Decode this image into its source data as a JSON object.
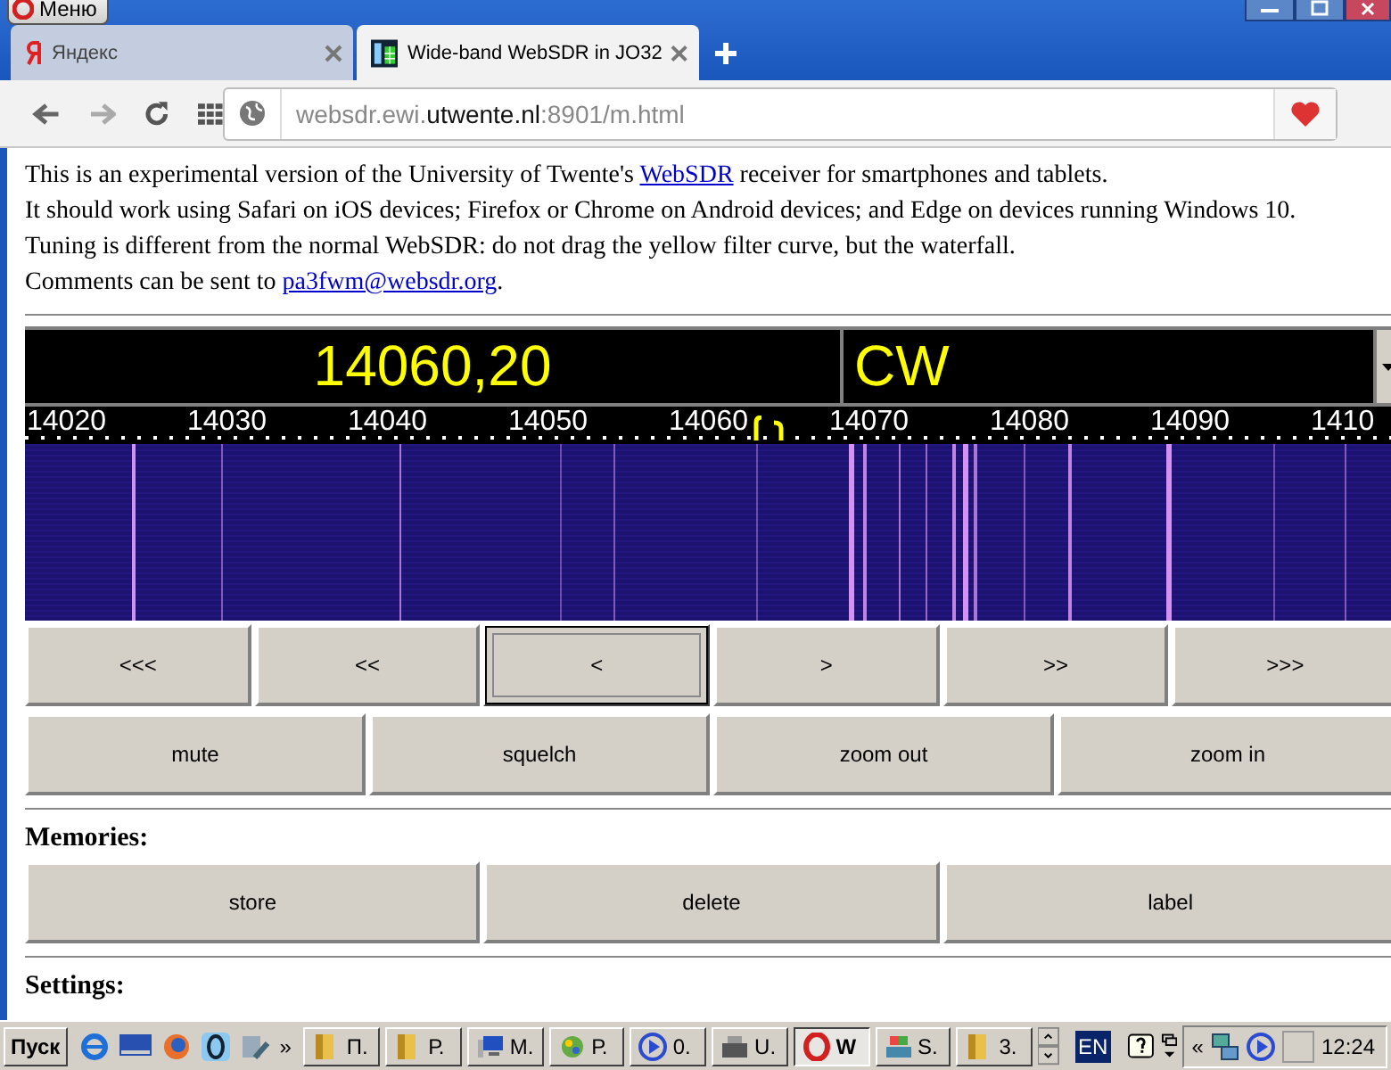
{
  "browser": {
    "menu_label": "Меню",
    "tabs": [
      {
        "title": "Яндекс",
        "selected": false
      },
      {
        "title": "Wide-band WebSDR in JO32",
        "selected": true
      }
    ],
    "url": {
      "host_prefix": "websdr.ewi.",
      "host_domain": "utwente.nl",
      "path": ":8901/m.html"
    }
  },
  "intro": [
    {
      "parts": [
        {
          "kind": "text",
          "text": "This is an experimental version of the University of Twente's "
        },
        {
          "kind": "link",
          "text": "WebSDR"
        },
        {
          "kind": "text",
          "text": " receiver for smartphones and tablets."
        }
      ]
    },
    {
      "parts": [
        {
          "kind": "text",
          "text": "It should work using Safari on iOS devices; Firefox or Chrome on Android devices; and Edge on devices running Windows 10."
        }
      ]
    },
    {
      "parts": [
        {
          "kind": "text",
          "text": "Tuning is different from the normal WebSDR: do not drag the yellow filter curve, but the waterfall."
        }
      ]
    },
    {
      "parts": [
        {
          "kind": "text",
          "text": "Comments can be sent to "
        },
        {
          "kind": "link",
          "text": "pa3fwm@websdr.org"
        },
        {
          "kind": "text",
          "text": "."
        }
      ]
    }
  ],
  "tuner": {
    "frequency": "14060,20",
    "mode": "CW",
    "scale": [
      "14020",
      "14030",
      "14040",
      "14050",
      "14060",
      "14070",
      "14080",
      "14090",
      "1410"
    ]
  },
  "controls": [
    [
      {
        "label": "<<<",
        "selected": false
      },
      {
        "label": "<<",
        "selected": false
      },
      {
        "label": "<",
        "selected": true
      },
      {
        "label": ">",
        "selected": false
      },
      {
        "label": ">>",
        "selected": false
      },
      {
        "label": ">>>",
        "selected": false
      }
    ],
    [
      {
        "label": "mute",
        "selected": false
      },
      {
        "label": "squelch",
        "selected": false
      },
      {
        "label": "zoom out",
        "selected": false
      },
      {
        "label": "zoom in",
        "selected": false
      }
    ]
  ],
  "memories": {
    "heading": "Memories:",
    "buttons": [
      "store",
      "delete",
      "label"
    ]
  },
  "settings": {
    "heading": "Settings:"
  },
  "taskbar": {
    "start": "Пуск",
    "tasks": [
      {
        "label": "П.",
        "kind": "folder",
        "selected": false
      },
      {
        "label": "Р.",
        "kind": "folder",
        "selected": false
      },
      {
        "label": "М.",
        "kind": "computer",
        "selected": false
      },
      {
        "label": "Р.",
        "kind": "paint",
        "selected": false
      },
      {
        "label": "0.",
        "kind": "player",
        "selected": false
      },
      {
        "label": "U.",
        "kind": "device",
        "selected": false
      },
      {
        "label": "W",
        "kind": "opera",
        "selected": true
      },
      {
        "label": "S.",
        "kind": "setup",
        "selected": false
      },
      {
        "label": "3.",
        "kind": "folder",
        "selected": false
      }
    ],
    "more_launchers": "»",
    "tray_expand": "«",
    "language": "EN",
    "clock": "12:24"
  }
}
